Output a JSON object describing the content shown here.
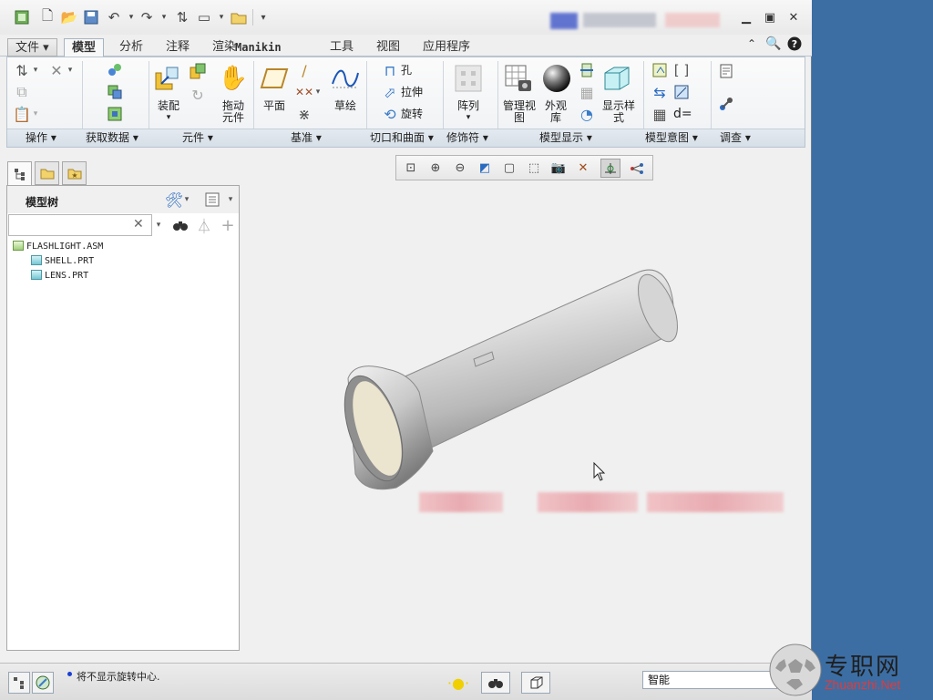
{
  "ribbon": {
    "tabs": [
      "文件",
      "模型",
      "分析",
      "注释",
      "渲染",
      "Manikin",
      "工具",
      "视图",
      "应用程序"
    ],
    "active_tab": "模型",
    "groups": [
      "操作",
      "获取数据",
      "元件",
      "基准",
      "切口和曲面",
      "修饰符",
      "模型显示",
      "模型意图",
      "调查"
    ],
    "buttons": {
      "assemble": "装配",
      "drag_components_1": "拖动",
      "drag_components_2": "元件",
      "plane": "平面",
      "sketch": "草绘",
      "hole": "孔",
      "extrude": "拉伸",
      "revolve": "旋转",
      "pattern": "阵列",
      "manage_views_1": "管理视",
      "manage_views_2": "图",
      "appearance_1": "外观",
      "appearance_2": "库",
      "display_style_1": "显示样",
      "display_style_2": "式",
      "relations_label": "d="
    }
  },
  "model_tree": {
    "title": "模型树",
    "search_value": "",
    "items": [
      {
        "name": "FLASHLIGHT.ASM",
        "level": 0,
        "kind": "asm"
      },
      {
        "name": "SHELL.PRT",
        "level": 1,
        "kind": "prt"
      },
      {
        "name": "LENS.PRT",
        "level": 1,
        "kind": "prt"
      }
    ]
  },
  "status": {
    "message": "将不显示旋转中心.",
    "filter": "智能"
  },
  "watermark": {
    "cn": "专职网",
    "en": "Zhuanzhi.Net"
  }
}
